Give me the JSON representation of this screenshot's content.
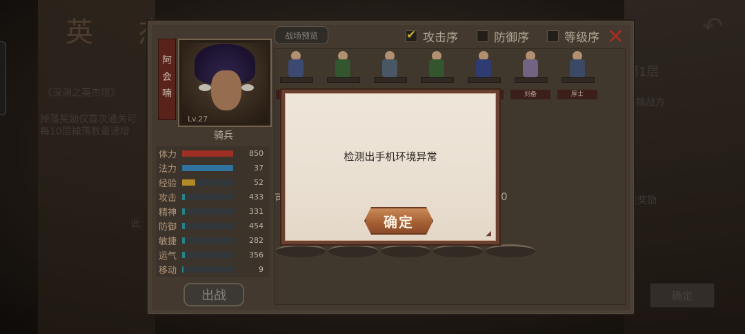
{
  "background": {
    "title": "英 杰",
    "tower_title": "《深渊之英杰塔》",
    "reward_line_1": "掉落奖励仅首次通关可",
    "reward_line_2": "每10层掉落数量递增",
    "floor": "第1层",
    "challenge_hint": "挑战方",
    "reward_hint": "关奖励",
    "confirm_label": "确定",
    "left_hint": "此"
  },
  "panel": {
    "preview_tab": "战场预览",
    "options": [
      {
        "label": "攻击序",
        "checked": true
      },
      {
        "label": "防御序",
        "checked": false
      },
      {
        "label": "等级序",
        "checked": false
      }
    ],
    "hero": {
      "name_chars": [
        "阿",
        "会",
        "喃"
      ],
      "level": "Lv.27",
      "class": "骑兵"
    },
    "stats": [
      {
        "label": "体力",
        "value": "850",
        "fill": 1.0,
        "color": "#c23a2c"
      },
      {
        "label": "法力",
        "value": "37",
        "fill": 1.0,
        "color": "#3a8cc0"
      },
      {
        "label": "经验",
        "value": "52",
        "fill": 0.25,
        "color": "#d8a830"
      },
      {
        "label": "攻击",
        "value": "433",
        "fill": 0.06,
        "color": "#2fa0a8"
      },
      {
        "label": "精神",
        "value": "331",
        "fill": 0.05,
        "color": "#2fa0a8"
      },
      {
        "label": "防御",
        "value": "454",
        "fill": 0.06,
        "color": "#2fa0a8"
      },
      {
        "label": "敏捷",
        "value": "282",
        "fill": 0.05,
        "color": "#2fa0a8"
      },
      {
        "label": "运气",
        "value": "356",
        "fill": 0.05,
        "color": "#2fa0a8"
      },
      {
        "label": "移动",
        "value": "9",
        "fill": 0.03,
        "color": "#2fa0a8"
      }
    ],
    "deploy_label": "出战",
    "units": [
      {
        "name": "",
        "color": "#4a5a8a"
      },
      {
        "name": "",
        "color": "#3f6a3a"
      },
      {
        "name": "",
        "color": "#5a6a7a"
      },
      {
        "name": "",
        "color": "#3f6a3a"
      },
      {
        "name": "",
        "color": "#3a4a8a"
      },
      {
        "name": "刘备",
        "color": "#8a7aa0"
      },
      {
        "name": "厚士",
        "color": "#4a5a7a"
      }
    ],
    "side_fragment_left": "可",
    "side_fragment_right": "0"
  },
  "dialog": {
    "message": "检测出手机环境异常",
    "ok_label": "确定"
  }
}
